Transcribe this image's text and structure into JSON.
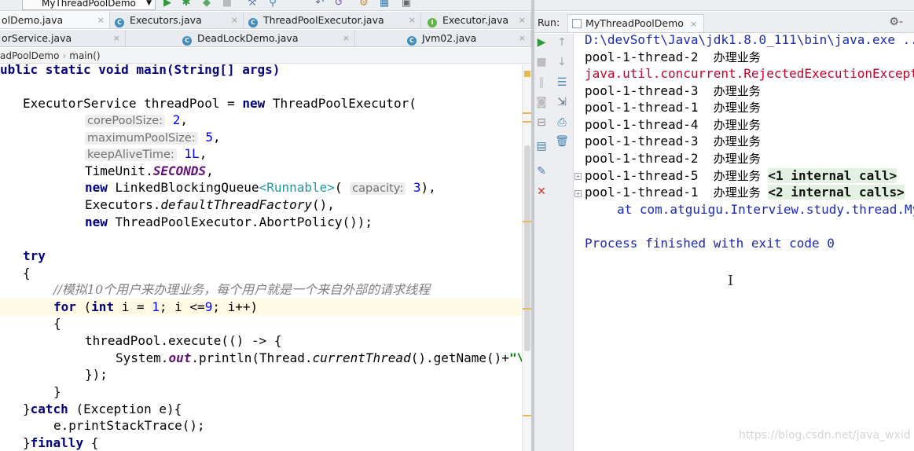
{
  "toolbar": {
    "run_config": "MyThreadPoolDemo",
    "icons": [
      "run-icon",
      "debug-icon",
      "coverage-icon",
      "stop-icon",
      "build-icon",
      "structure-icon",
      "project-structure-icon"
    ]
  },
  "editor_tabs": {
    "row1": [
      {
        "label": "olDemo.java",
        "active": true
      },
      {
        "label": "Executors.java",
        "active": false
      },
      {
        "label": "ThreadPoolExecutor.java",
        "active": false
      },
      {
        "label": "Executor.java",
        "active": false
      }
    ],
    "row2": [
      {
        "label": "orService.java",
        "active": false
      },
      {
        "label": "DeadLockDemo.java",
        "active": false
      },
      {
        "label": "Jvm02.java",
        "active": false
      }
    ],
    "close_glyph": "×"
  },
  "breadcrumb": {
    "items": [
      "adPoolDemo",
      "main()"
    ],
    "separator": "›"
  },
  "code": {
    "l0": {
      "a": "ublic static void main(String[] args)"
    },
    "l1": {
      "a": "ExecutorService threadPool = ",
      "kw": "new",
      "b": " ThreadPoolExecutor("
    },
    "l2": {
      "hint": "corePoolSize:",
      "num": "2",
      "tail": ","
    },
    "l3": {
      "hint": "maximumPoolSize:",
      "num": "5",
      "tail": ","
    },
    "l4": {
      "hint": "keepAliveTime:",
      "num": "1L",
      "tail": ","
    },
    "l5": {
      "a": "TimeUnit.",
      "fld": "SECONDS",
      "tail": ","
    },
    "l6": {
      "kw": "new",
      "a": " LinkedBlockingQueue",
      "gen": "<Runnable>",
      "b": "(",
      "hint": "capacity:",
      "num": "3",
      "tail": "),"
    },
    "l7": {
      "a": "Executors.",
      "ital": "defaultThreadFactory",
      "tail": "(),"
    },
    "l8": {
      "kw": "new",
      "a": " ThreadPoolExecutor.AbortPolicy());"
    },
    "l9": {
      "kw": "try"
    },
    "l10": {
      "a": "{"
    },
    "l11": {
      "cmt": "//模拟10个用户来办理业务，每个用户就是一个来自外部的请求线程"
    },
    "l12": {
      "kw": "for",
      "a": " (",
      "kw2": "int",
      "b": " i = ",
      "num": "1",
      "c": "; i <=",
      "num2": "9",
      "d": "; i++)"
    },
    "l13": {
      "a": "{"
    },
    "l14": {
      "a": "threadPool.execute(() -> {"
    },
    "l15": {
      "a": "System.",
      "fld": "out",
      "b": ".println(Thread.",
      "ital": "currentThread",
      "c": "().getName()+",
      "str": "\"\\"
    },
    "l16": {
      "a": "});"
    },
    "l17": {
      "a": "}"
    },
    "l18": {
      "a": "}",
      "kw": "catch",
      "b": " (Exception e){"
    },
    "l19": {
      "a": "e.printStackTrace();"
    },
    "l20": {
      "a": "}",
      "kw": "finally",
      "b": " {"
    }
  },
  "run_panel": {
    "label": "Run:",
    "tab_label": "MyThreadPoolDemo",
    "close_glyph": "×",
    "gear_glyph": "⚙-",
    "tool_icons": [
      "rerun-icon",
      "scroll-up-icon",
      "stop-icon",
      "scroll-down-icon",
      "pause-icon",
      "soft-wrap-icon",
      "camera-icon",
      "scroll-to-end-icon",
      "restore-layout-icon",
      "print-icon",
      "trash-icon",
      "pin-icon",
      "close-icon"
    ]
  },
  "console": {
    "lines": [
      {
        "text": "D:\\devSoft\\Java\\jdk1.8.0_111\\bin\\java.exe ...",
        "kind": "blue"
      },
      {
        "text": "pool-1-thread-2",
        "zh": "办理业务",
        "kind": "normal"
      },
      {
        "text": "java.util.concurrent.RejectedExecutionException",
        "kind": "err"
      },
      {
        "text": "pool-1-thread-3",
        "zh": "办理业务",
        "kind": "normal"
      },
      {
        "text": "pool-1-thread-1",
        "zh": "办理业务",
        "kind": "normal"
      },
      {
        "text": "pool-1-thread-4",
        "zh": "办理业务",
        "kind": "normal"
      },
      {
        "text": "pool-1-thread-3",
        "zh": "办理业务",
        "kind": "normal"
      },
      {
        "text": "pool-1-thread-2",
        "zh": "办理业务",
        "kind": "normal"
      },
      {
        "text": "pool-1-thread-5",
        "zh": "办理业务",
        "internal": "<1 internal call>",
        "kind": "normal"
      },
      {
        "text": "pool-1-thread-1",
        "zh": "办理业务",
        "internal": "<2 internal calls>",
        "kind": "normal"
      },
      {
        "text": "at com.atguigu.Interview.study.thread.MyThreadPoolDemo",
        "kind": "stack"
      },
      {
        "text": "",
        "kind": "normal"
      },
      {
        "text": "Process finished with exit code 0",
        "kind": "blue"
      }
    ]
  },
  "watermark": "https://blog.csdn.net/java_wxid",
  "colors": {
    "keyword": "#000080",
    "number": "#0000ff",
    "error": "#c8002a",
    "console_blue": "#1a2ab4",
    "comment": "#808080",
    "static_field": "#660e7a"
  }
}
